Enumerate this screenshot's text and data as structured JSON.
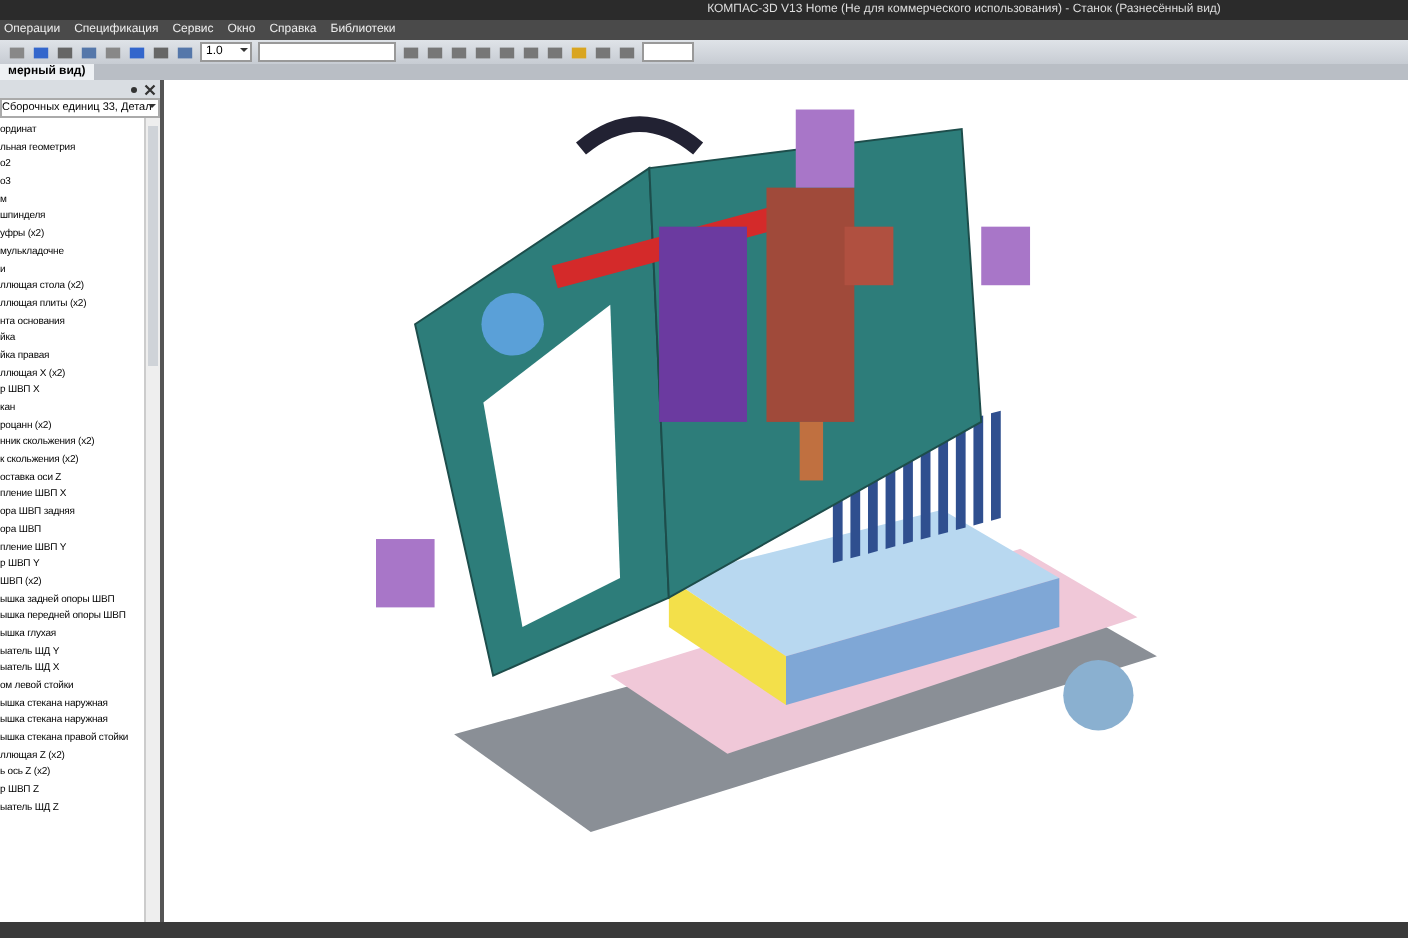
{
  "window": {
    "title": "КОМПАС-3D V13 Home (Не для коммерческого использования) - Станок (Разнесённый вид)"
  },
  "menu": [
    "Операции",
    "Спецификация",
    "Сервис",
    "Окно",
    "Справка",
    "Библиотеки"
  ],
  "toolbar": {
    "scale": "1.0"
  },
  "tab": {
    "label": "мерный вид)",
    "selected": true
  },
  "tree": {
    "filter": "Сборочных единиц 33, Детал",
    "items": [
      {
        "label": "ординат"
      },
      {
        "label": "льная геометрия"
      },
      {
        "label": "о2"
      },
      {
        "label": "о3"
      },
      {
        "label": "м"
      },
      {
        "label": "шпинделя"
      },
      {
        "label": "уфры (х2)"
      },
      {
        "label": "мулькладочне"
      },
      {
        "label": "и"
      },
      {
        "label": "ллющая стола (х2)"
      },
      {
        "label": "ллющая плиты (х2)"
      },
      {
        "label": "нта основания"
      },
      {
        "label": "йка"
      },
      {
        "label": "йка правая"
      },
      {
        "label": "ллющая Х (х2)"
      },
      {
        "label": "р ШВП Х"
      },
      {
        "label": "кан"
      },
      {
        "label": "роцанн (х2)"
      },
      {
        "label": "нник скольжения (х2)"
      },
      {
        "label": "к скольжения (х2)"
      },
      {
        "label": "оставка оси Z"
      },
      {
        "label": "пление ШВП Х"
      },
      {
        "label": "ора ШВП задняя"
      },
      {
        "label": "ора ШВП"
      },
      {
        "label": "пление ШВП Y"
      },
      {
        "label": "р ШВП Y"
      },
      {
        "label": "ШВП (х2)"
      },
      {
        "label": "ышка задней опоры ШВП"
      },
      {
        "label": "ышка передней опоры ШВП"
      },
      {
        "label": "ышка глухая"
      },
      {
        "label": "ыатель ШД Y"
      },
      {
        "label": "ыатель ШД Х"
      },
      {
        "label": "ом левой стойки"
      },
      {
        "label": "ышка стекана наружная"
      },
      {
        "label": "ышка стекана наружная"
      },
      {
        "label": "ышка стекана правой стойки"
      },
      {
        "label": "ллющая Z (х2)"
      },
      {
        "label": "ь ось Z (х2)"
      },
      {
        "label": "р ШВП Z"
      },
      {
        "label": "ыатель ШД Z"
      }
    ]
  }
}
